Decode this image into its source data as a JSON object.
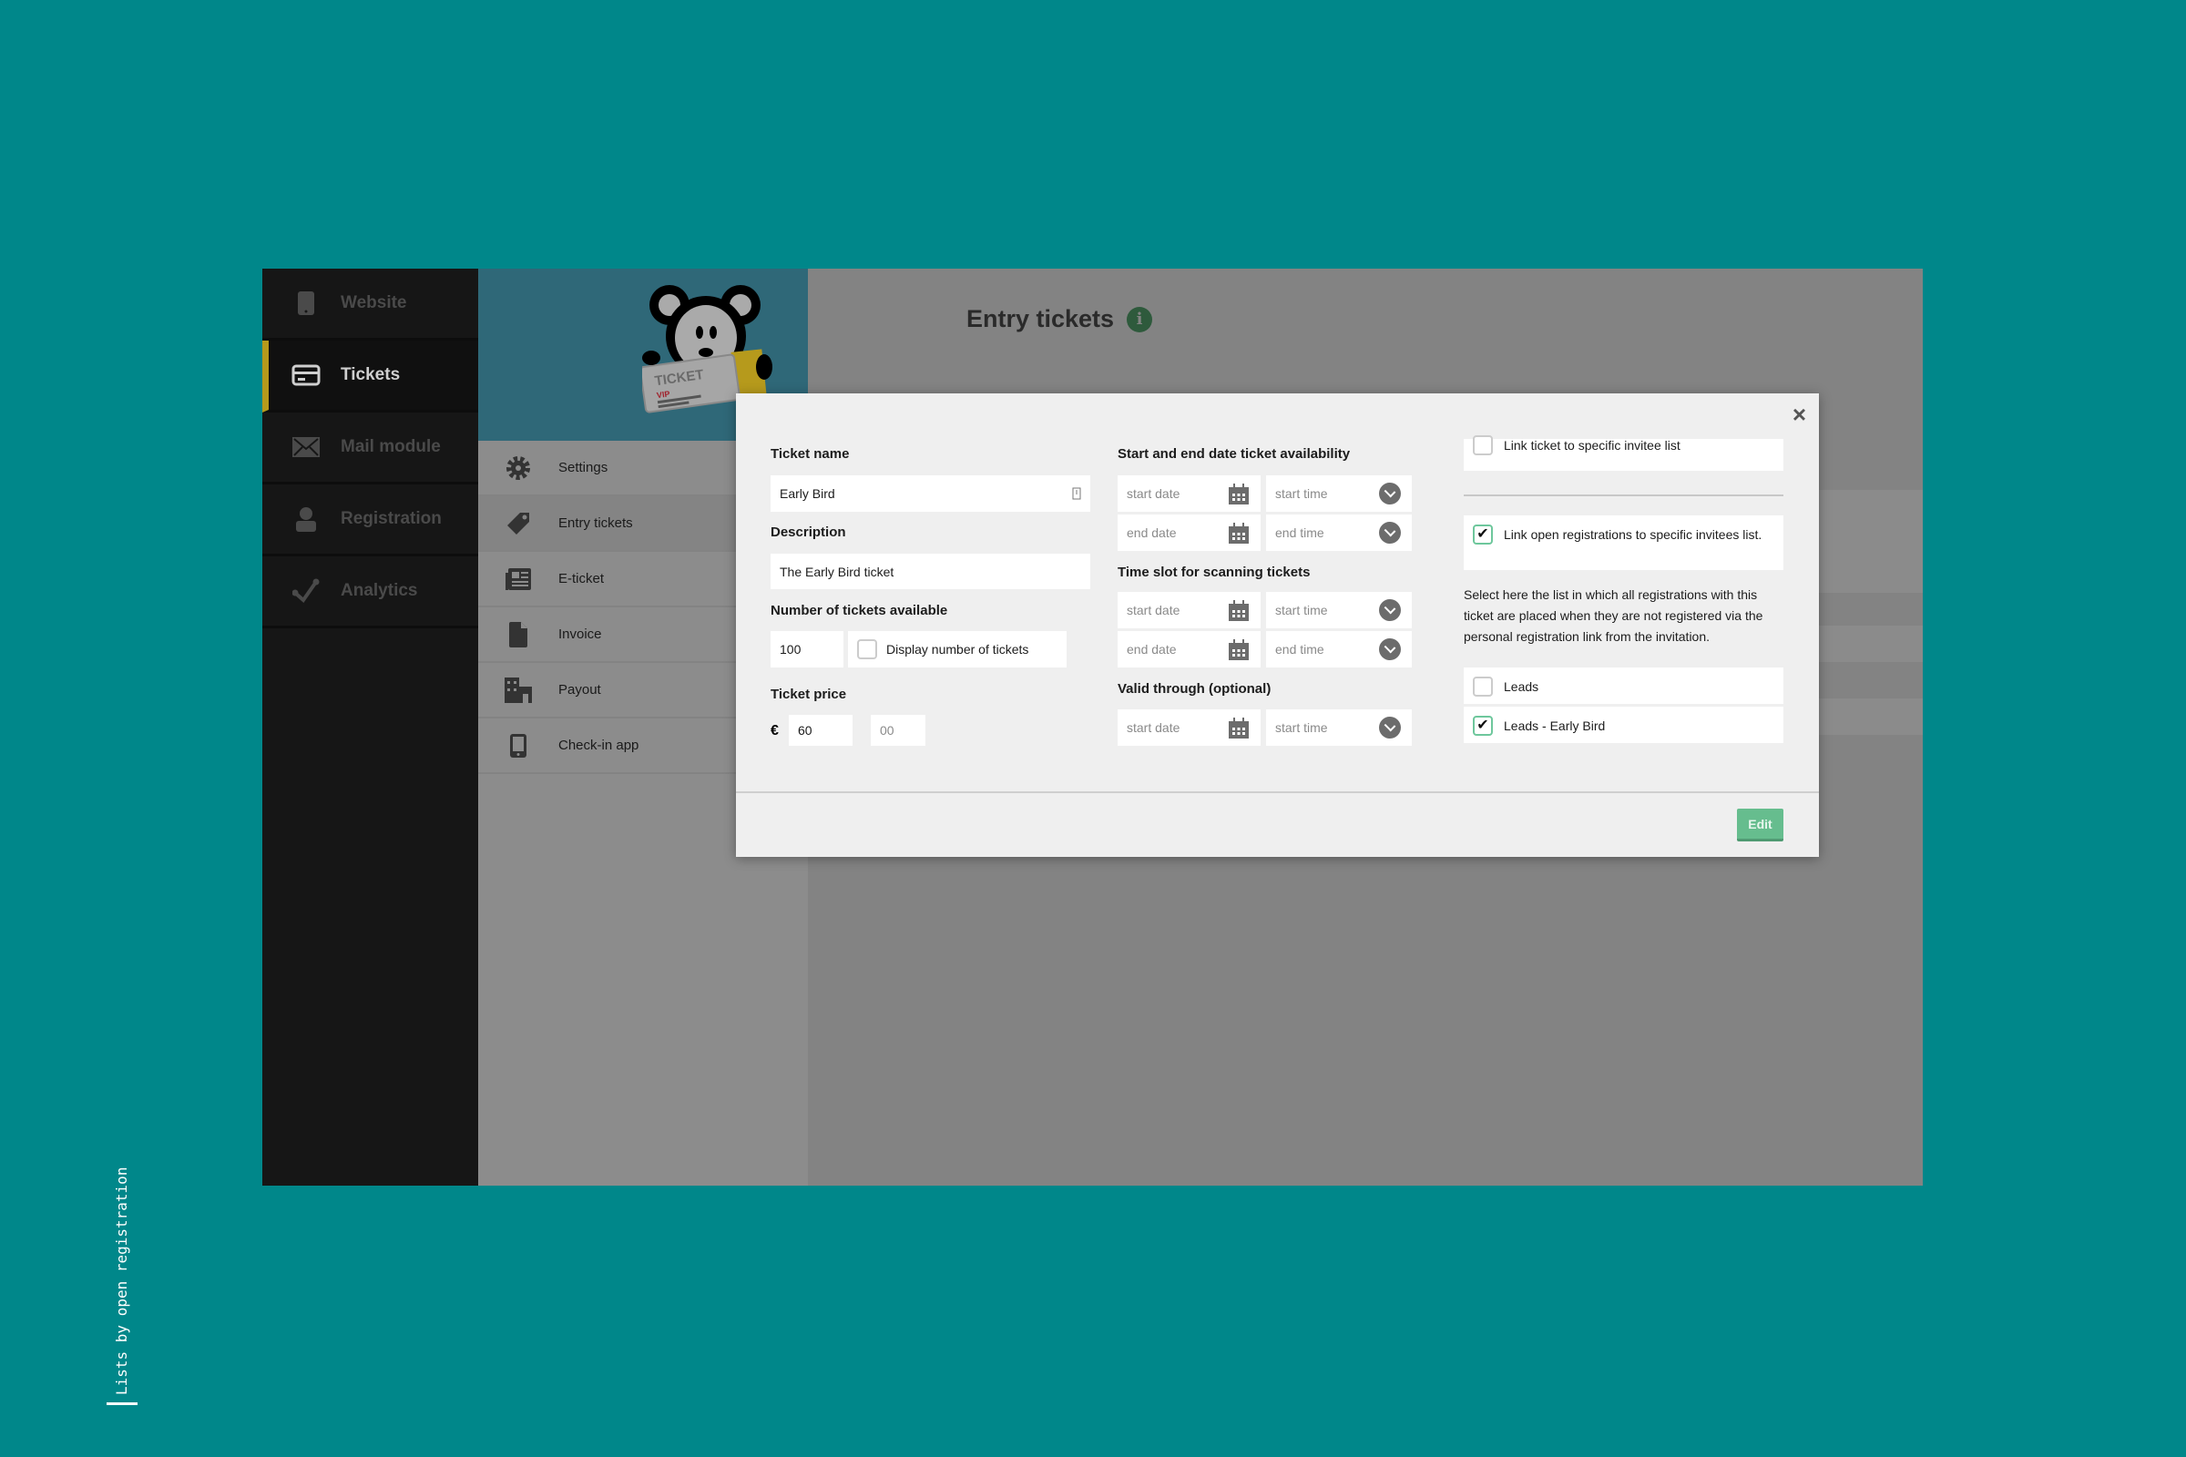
{
  "colors": {
    "background": "#00878a",
    "accent": "#b69a1c",
    "edit_button": "#66bd8e",
    "checkbox_checked": "#6ec79c"
  },
  "sidebar": {
    "items": [
      {
        "label": "Website",
        "icon": "phone-icon"
      },
      {
        "label": "Tickets",
        "icon": "ticket-card-icon",
        "active": true
      },
      {
        "label": "Mail module",
        "icon": "mail-icon"
      },
      {
        "label": "Registration",
        "icon": "user-icon"
      },
      {
        "label": "Analytics",
        "icon": "analytics-icon"
      }
    ]
  },
  "subnav": {
    "mascot_ticket_text": "TICKET",
    "mascot_vip_text": "VIP",
    "items": [
      {
        "label": "Settings",
        "icon": "gear-icon"
      },
      {
        "label": "Entry tickets",
        "icon": "tag-icon",
        "active": true
      },
      {
        "label": "E-ticket",
        "icon": "newspaper-icon"
      },
      {
        "label": "Invoice",
        "icon": "file-icon"
      },
      {
        "label": "Payout",
        "icon": "building-icon"
      },
      {
        "label": "Check-in app",
        "icon": "phone-icon"
      }
    ]
  },
  "main": {
    "title": "Entry tickets",
    "info_icon": "i"
  },
  "modal": {
    "close": "×",
    "ticket_name_label": "Ticket name",
    "ticket_name": "Early Bird",
    "description_label": "Description",
    "description": "The Early Bird ticket",
    "number_label": "Number of tickets available",
    "number": "100",
    "display_number_label": "Display number of tickets",
    "price_label": "Ticket price",
    "currency": "€",
    "price_whole": "60",
    "price_cents_placeholder": "00",
    "availability_label": "Start and end date ticket availability",
    "timeslot_label": "Time slot for scanning tickets",
    "valid_label": "Valid through (optional)",
    "start_date": "start date",
    "end_date": "end date",
    "start_time": "start time",
    "end_time": "end time",
    "link_invitee_label": "Link ticket to specific invitee list",
    "link_invitee_checked": false,
    "link_open_label": "Link open registrations to specific invitees list.",
    "link_open_checked": true,
    "help_text": "Select here the list in which all registrations with this ticket are placed when they are not registered via the personal registration link from the invitation.",
    "lists": [
      {
        "label": "Leads",
        "checked": false
      },
      {
        "label": "Leads - Early Bird",
        "checked": true
      }
    ],
    "edit_label": "Edit"
  },
  "caption": "Lists by open registration"
}
